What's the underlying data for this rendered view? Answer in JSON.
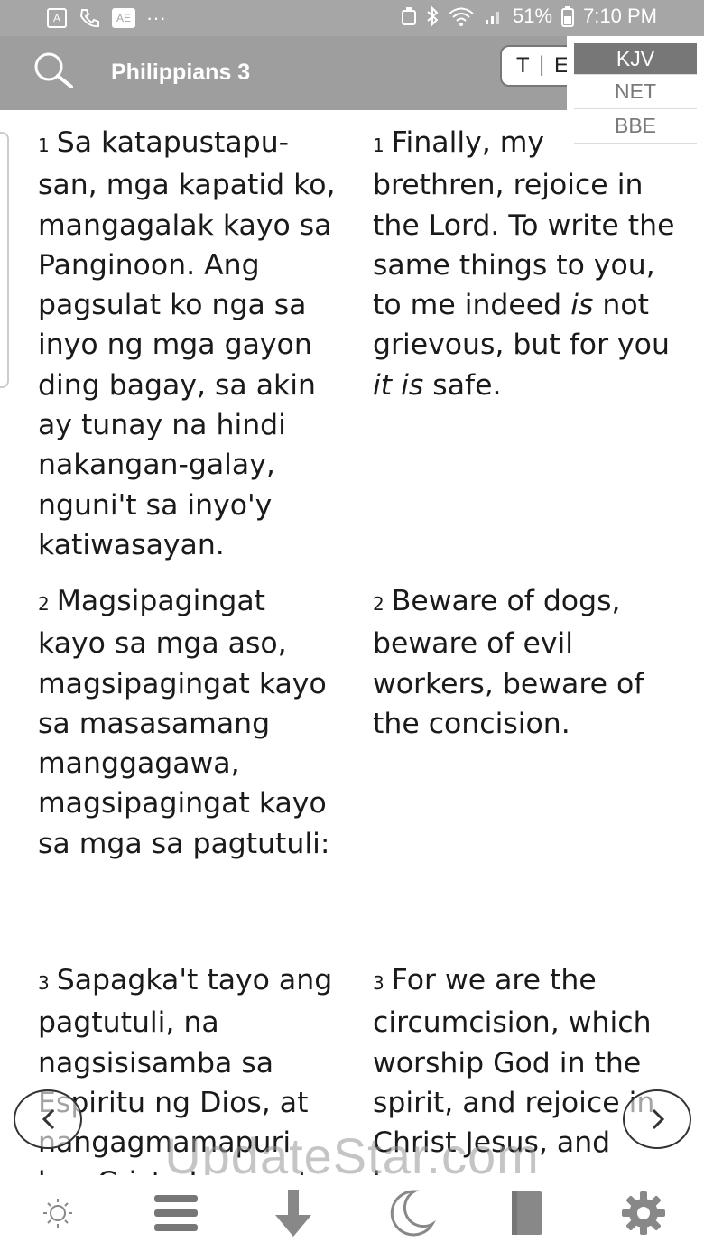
{
  "status": {
    "time": "7:10 PM",
    "battery": "51%",
    "more": "···"
  },
  "appbar": {
    "title": "Philippians 3",
    "toggle_t": "T",
    "toggle_e": "E"
  },
  "versions": [
    "KJV",
    "NET",
    "BBE"
  ],
  "tagalog": [
    {
      "n": "1",
      "text": "Sa katapustapu-san, mga kapatid ko, mangagalak kayo sa Panginoon. Ang pagsulat ko nga sa inyo ng mga gayon ding bagay, sa akin ay tunay na hindi nakangan-galay, nguni't sa inyo'y katiwasayan."
    },
    {
      "n": "2",
      "text": "Magsipagingat kayo sa mga aso, magsipagingat kayo sa masasamang manggagawa, magsipagingat kayo sa mga sa pagtutuli:"
    },
    {
      "n": "3",
      "text": "Sapagka't tayo ang pagtutuli, na nagsisisamba sa Espiritu ng Dios, at nangagmamapuri kay Cristo Jesus, at"
    }
  ],
  "english": [
    {
      "n": "1",
      "a": "Finally, my brethren, rejoice in the Lord. To write the same things to you, to me indeed ",
      "i1": "is",
      "b": " not grievous, but for you ",
      "i2": "it is",
      "c": " safe."
    },
    {
      "n": "2",
      "text": "Beware of dogs, beware of evil workers, beware of the concision."
    },
    {
      "n": "3",
      "text": "For we are the circumcision, which worship God in the spirit, and rejoice in Christ Jesus, and have"
    }
  ],
  "watermark": "UpdateStar.com",
  "icons": {
    "search": "search-icon",
    "brightness": "brightness-icon",
    "menu": "menu-icon",
    "download": "download-icon",
    "night": "moon-icon",
    "book": "book-icon",
    "settings": "gear-icon",
    "prev": "chevron-left-icon",
    "next": "chevron-right-icon"
  },
  "colors": {
    "appbar": "#9e9e9e",
    "statusbar": "#a6a6a6",
    "selected_version": "#777777"
  }
}
